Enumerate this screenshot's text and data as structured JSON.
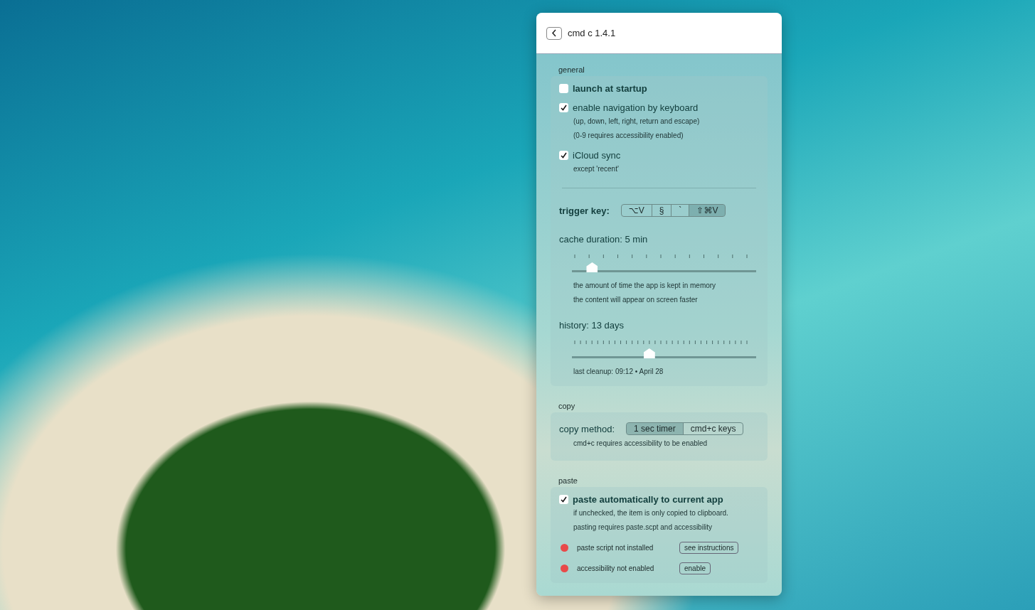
{
  "window": {
    "title": "cmd c 1.4.1"
  },
  "sections": [
    {
      "title": "general",
      "rows": [
        {
          "kind": "checkbox",
          "label": "launch at startup",
          "bold": true,
          "checked": false,
          "notes": []
        },
        {
          "kind": "checkbox",
          "label": "enable navigation by keyboard",
          "bold": false,
          "checked": true,
          "notes": [
            "(up, down, left, right, return and escape)",
            "(0-9 requires accessibility enabled)"
          ]
        },
        {
          "kind": "checkbox",
          "label": "iCloud sync",
          "bold": false,
          "checked": true,
          "notes": [
            "except 'recent'"
          ]
        },
        {
          "kind": "divider"
        },
        {
          "kind": "segmented",
          "label": "trigger key:",
          "bold": true,
          "options": [
            {
              "label": "⌥V",
              "selected": false
            },
            {
              "label": "§",
              "selected": false
            },
            {
              "label": "`",
              "selected": false
            },
            {
              "label": "⇧⌘V",
              "selected": true
            }
          ],
          "notes": []
        },
        {
          "kind": "slider",
          "label": "cache duration: 5 min",
          "level": 0.11,
          "notes": [
            "the amount of time the app is kept in memory",
            "the content will appear on screen faster"
          ]
        },
        {
          "kind": "slider",
          "label": "history: 13 days",
          "level": 0.42,
          "notes": [
            "last cleanup: 09:12 • April 28"
          ]
        }
      ]
    },
    {
      "title": "copy",
      "rows": [
        {
          "kind": "segmented",
          "label": "copy method:",
          "bold": false,
          "options": [
            {
              "label": "1 sec timer",
              "selected": true
            },
            {
              "label": "cmd+c keys",
              "selected": false
            }
          ],
          "notes": [
            "cmd+c requires accessibility to be enabled"
          ]
        }
      ]
    },
    {
      "title": "paste",
      "rows": [
        {
          "kind": "checkbox",
          "label": "paste automatically to current app",
          "bold": true,
          "checked": true,
          "notes": [
            "if unchecked, the item is only copied to clipboard.",
            "pasting requires paste.scpt and accessibility"
          ]
        },
        {
          "kind": "status",
          "label": "paste script not installed",
          "color": "#e84a4a",
          "button": "see instructions"
        },
        {
          "kind": "status",
          "label": "accessibility not enabled",
          "color": "#e84a4a",
          "button": "enable"
        }
      ]
    }
  ]
}
